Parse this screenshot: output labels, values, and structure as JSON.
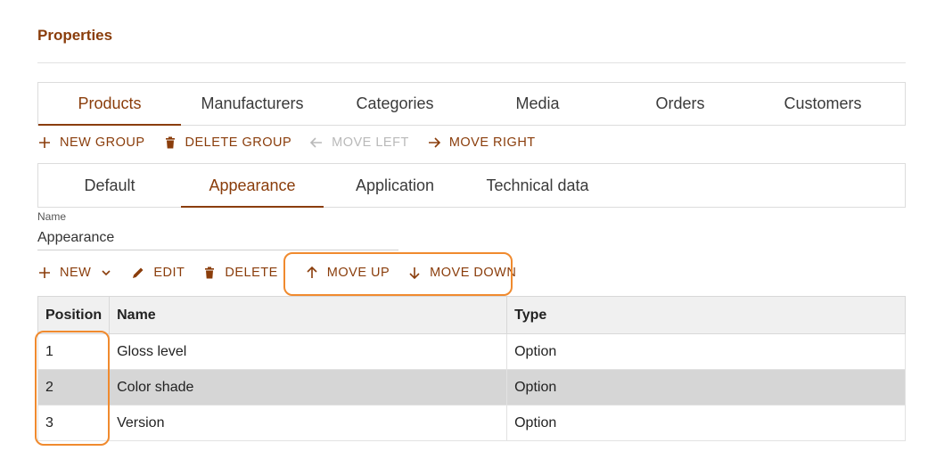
{
  "page": {
    "title": "Properties"
  },
  "main_tabs": [
    {
      "label": "Products",
      "active": true
    },
    {
      "label": "Manufacturers",
      "active": false
    },
    {
      "label": "Categories",
      "active": false
    },
    {
      "label": "Media",
      "active": false
    },
    {
      "label": "Orders",
      "active": false
    },
    {
      "label": "Customers",
      "active": false
    }
  ],
  "group_toolbar": {
    "new_group": "NEW GROUP",
    "delete_group": "DELETE GROUP",
    "move_left": "MOVE LEFT",
    "move_right": "MOVE RIGHT"
  },
  "group_tabs": [
    {
      "label": "Default",
      "active": false
    },
    {
      "label": "Appearance",
      "active": true
    },
    {
      "label": "Application",
      "active": false
    },
    {
      "label": "Technical data",
      "active": false
    }
  ],
  "name_field": {
    "label": "Name",
    "value": "Appearance"
  },
  "item_toolbar": {
    "new": "NEW",
    "edit": "EDIT",
    "delete": "DELETE",
    "move_up": "MOVE UP",
    "move_down": "MOVE DOWN"
  },
  "table": {
    "headers": [
      "Position",
      "Name",
      "Type"
    ],
    "rows": [
      {
        "position": "1",
        "name": "Gloss level",
        "type": "Option",
        "selected": false
      },
      {
        "position": "2",
        "name": "Color shade",
        "type": "Option",
        "selected": true
      },
      {
        "position": "3",
        "name": "Version",
        "type": "Option",
        "selected": false
      }
    ]
  },
  "colors": {
    "accent": "#8a3d0b",
    "highlight": "#f08a2e",
    "disabled": "#b9b9b9",
    "selected_row": "#d6d6d6"
  },
  "icons": {
    "new_group": "plus-icon",
    "delete_group": "trash-icon",
    "move_left": "arrow-left-icon",
    "move_right": "arrow-right-icon",
    "new": "plus-icon",
    "new_menu": "chevron-down-icon",
    "edit": "pencil-icon",
    "delete": "trash-icon",
    "move_up": "arrow-up-icon",
    "move_down": "arrow-down-icon"
  }
}
